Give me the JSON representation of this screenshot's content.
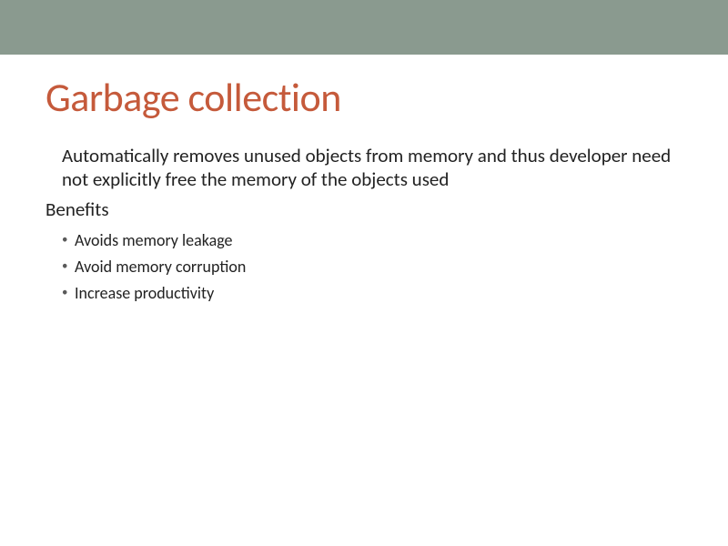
{
  "slide": {
    "title": "Garbage collection",
    "paragraph": "Automatically removes unused objects from memory and thus developer need not explicitly  free the memory of the objects used",
    "subheading": "Benefits",
    "bullets": [
      "Avoids memory leakage",
      "Avoid memory corruption",
      "Increase productivity"
    ]
  },
  "colors": {
    "topbar": "#8a9a8f",
    "title": "#c55a3b"
  }
}
